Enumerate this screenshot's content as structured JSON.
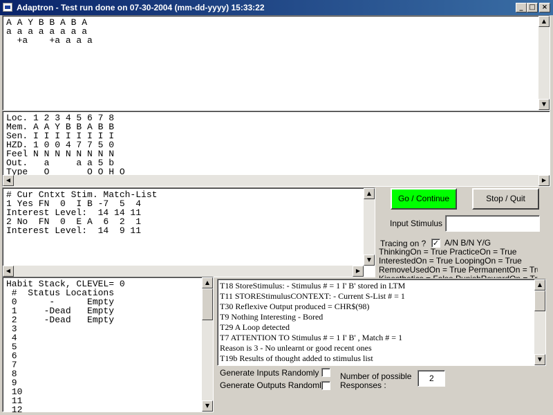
{
  "window": {
    "title": "Adaptron  -  Test run done on 07-30-2004 (mm-dd-yyyy) 15:33:22",
    "minimize_glyph": "_",
    "maximize_glyph": "□",
    "close_glyph": "×"
  },
  "top_panel": {
    "lines": [
      "A A Y B B A B A",
      "a a a a a a a a",
      "  +a    +a a a a"
    ]
  },
  "memory_panel": {
    "lines": [
      "Loc. 1 2 3 4 5 6 7 8",
      "Mem. A A Y B B A B B",
      "Sen. I I I I I I I I",
      "HZD. 1 0 0 4 7 7 5 0",
      "Feel N N N N N N N N",
      "Out.   a     a a 5 b",
      "Type   O       O O H O"
    ]
  },
  "context_panel": {
    "lines": [
      "# Cur Cntxt Stim. Match-List",
      "1 Yes FN  0  I B -7  5  4",
      "Interest Level:  14 14 11",
      "2 No  FN  0  E A  6  2  1",
      "Interest Level:  14  9 11"
    ]
  },
  "controls": {
    "go_label": "Go / Continue",
    "stop_label": "Stop / Quit",
    "input_stimulus_label": "Input Stimulus :",
    "input_stimulus_value": "",
    "tracing_label": "Tracing on ?",
    "tracing_checked": "✓",
    "tracing_modes": "A/N  B/N  Y/G",
    "flags": [
      "ThinkingOn = True PracticeOn = True",
      "InterestedOn = True LoopingOn = True",
      "RemoveUsedOn = True PermanentOn = True",
      "Kinesthetics = False PunishRewardOn = True"
    ]
  },
  "habit_panel": {
    "lines": [
      "Habit Stack, CLEVEL= 0",
      " #  Status Locations",
      " 0      -      Empty",
      " 1     -Dead   Empty",
      " 2     -Dead   Empty",
      " 3",
      " 4",
      " 5",
      " 6",
      " 7",
      " 8",
      " 9",
      " 10",
      " 11",
      " 12"
    ]
  },
  "log_panel": {
    "lines": [
      "T18 StoreStimulus: - Stimulus # = 1 I' B'  stored in LTM",
      "T11 STOREStimulusCONTEXT: - Current S-List # = 1",
      "T30 Reflexive Output produced = CHR$(98)",
      "T9   Nothing Interesting - Bored",
      "T29 A Loop detected",
      "T7   ATTENTION TO Stimulus # = 1 I' B' , Match # = 1",
      "  Reason is 3 - No unlearnt or good recent ones",
      "T19b Results of thought added to stimulus list"
    ]
  },
  "bottom": {
    "gen_inputs_label": "Generate Inputs Randomly ?",
    "gen_outputs_label": "Generate Outputs Randomly?",
    "responses_label_1": "Number of possible",
    "responses_label_2": "Responses :",
    "responses_value": "2"
  },
  "colors": {
    "go_button": "#00ff00",
    "title_start": "#0a246a",
    "title_end": "#3a6ea5"
  }
}
